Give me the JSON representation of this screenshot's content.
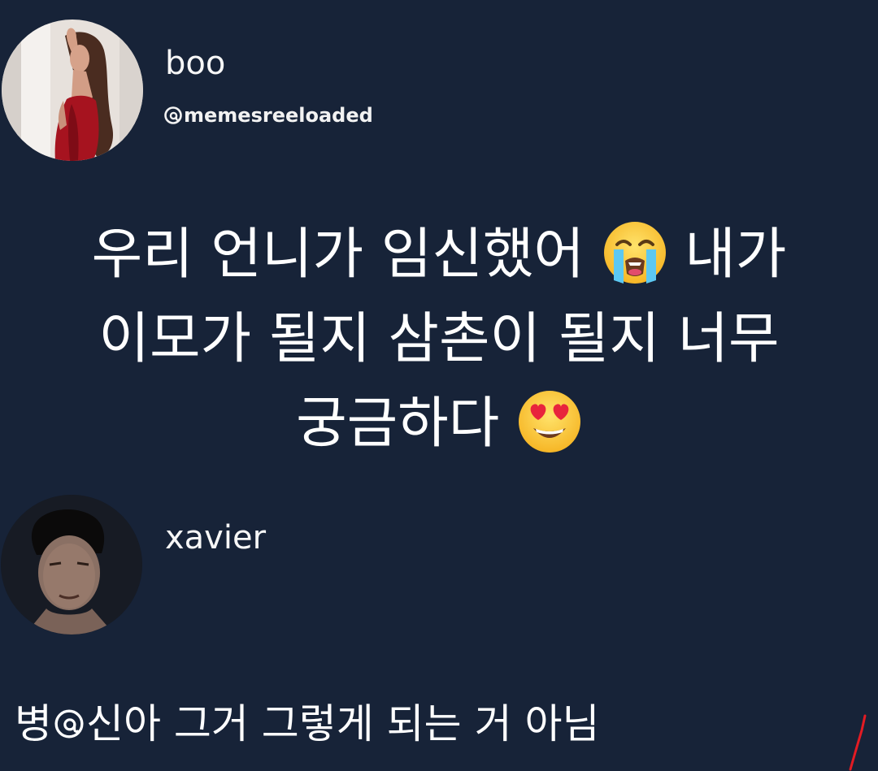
{
  "post": {
    "author": {
      "name": "boo",
      "handle": "memesreeloaded",
      "avatar_icon": "profile-photo-woman"
    },
    "text_lines": [
      "우리 언니가 임신했어",
      "내가",
      "이모가 될지 삼촌이 될지 너무",
      "궁금하다"
    ],
    "emojis": [
      "loudly-crying-face-emoji",
      "smiling-face-with-heart-eyes-emoji"
    ]
  },
  "reply": {
    "author": {
      "name": "xavier",
      "avatar_icon": "profile-photo-man"
    },
    "text_before_icon": "병",
    "text_after_icon": "신아 그거 그렇게 되는 거 아님",
    "inline_icon": "threads-logo-icon"
  },
  "colors": {
    "background": "#172338",
    "text": "#ffffff"
  }
}
